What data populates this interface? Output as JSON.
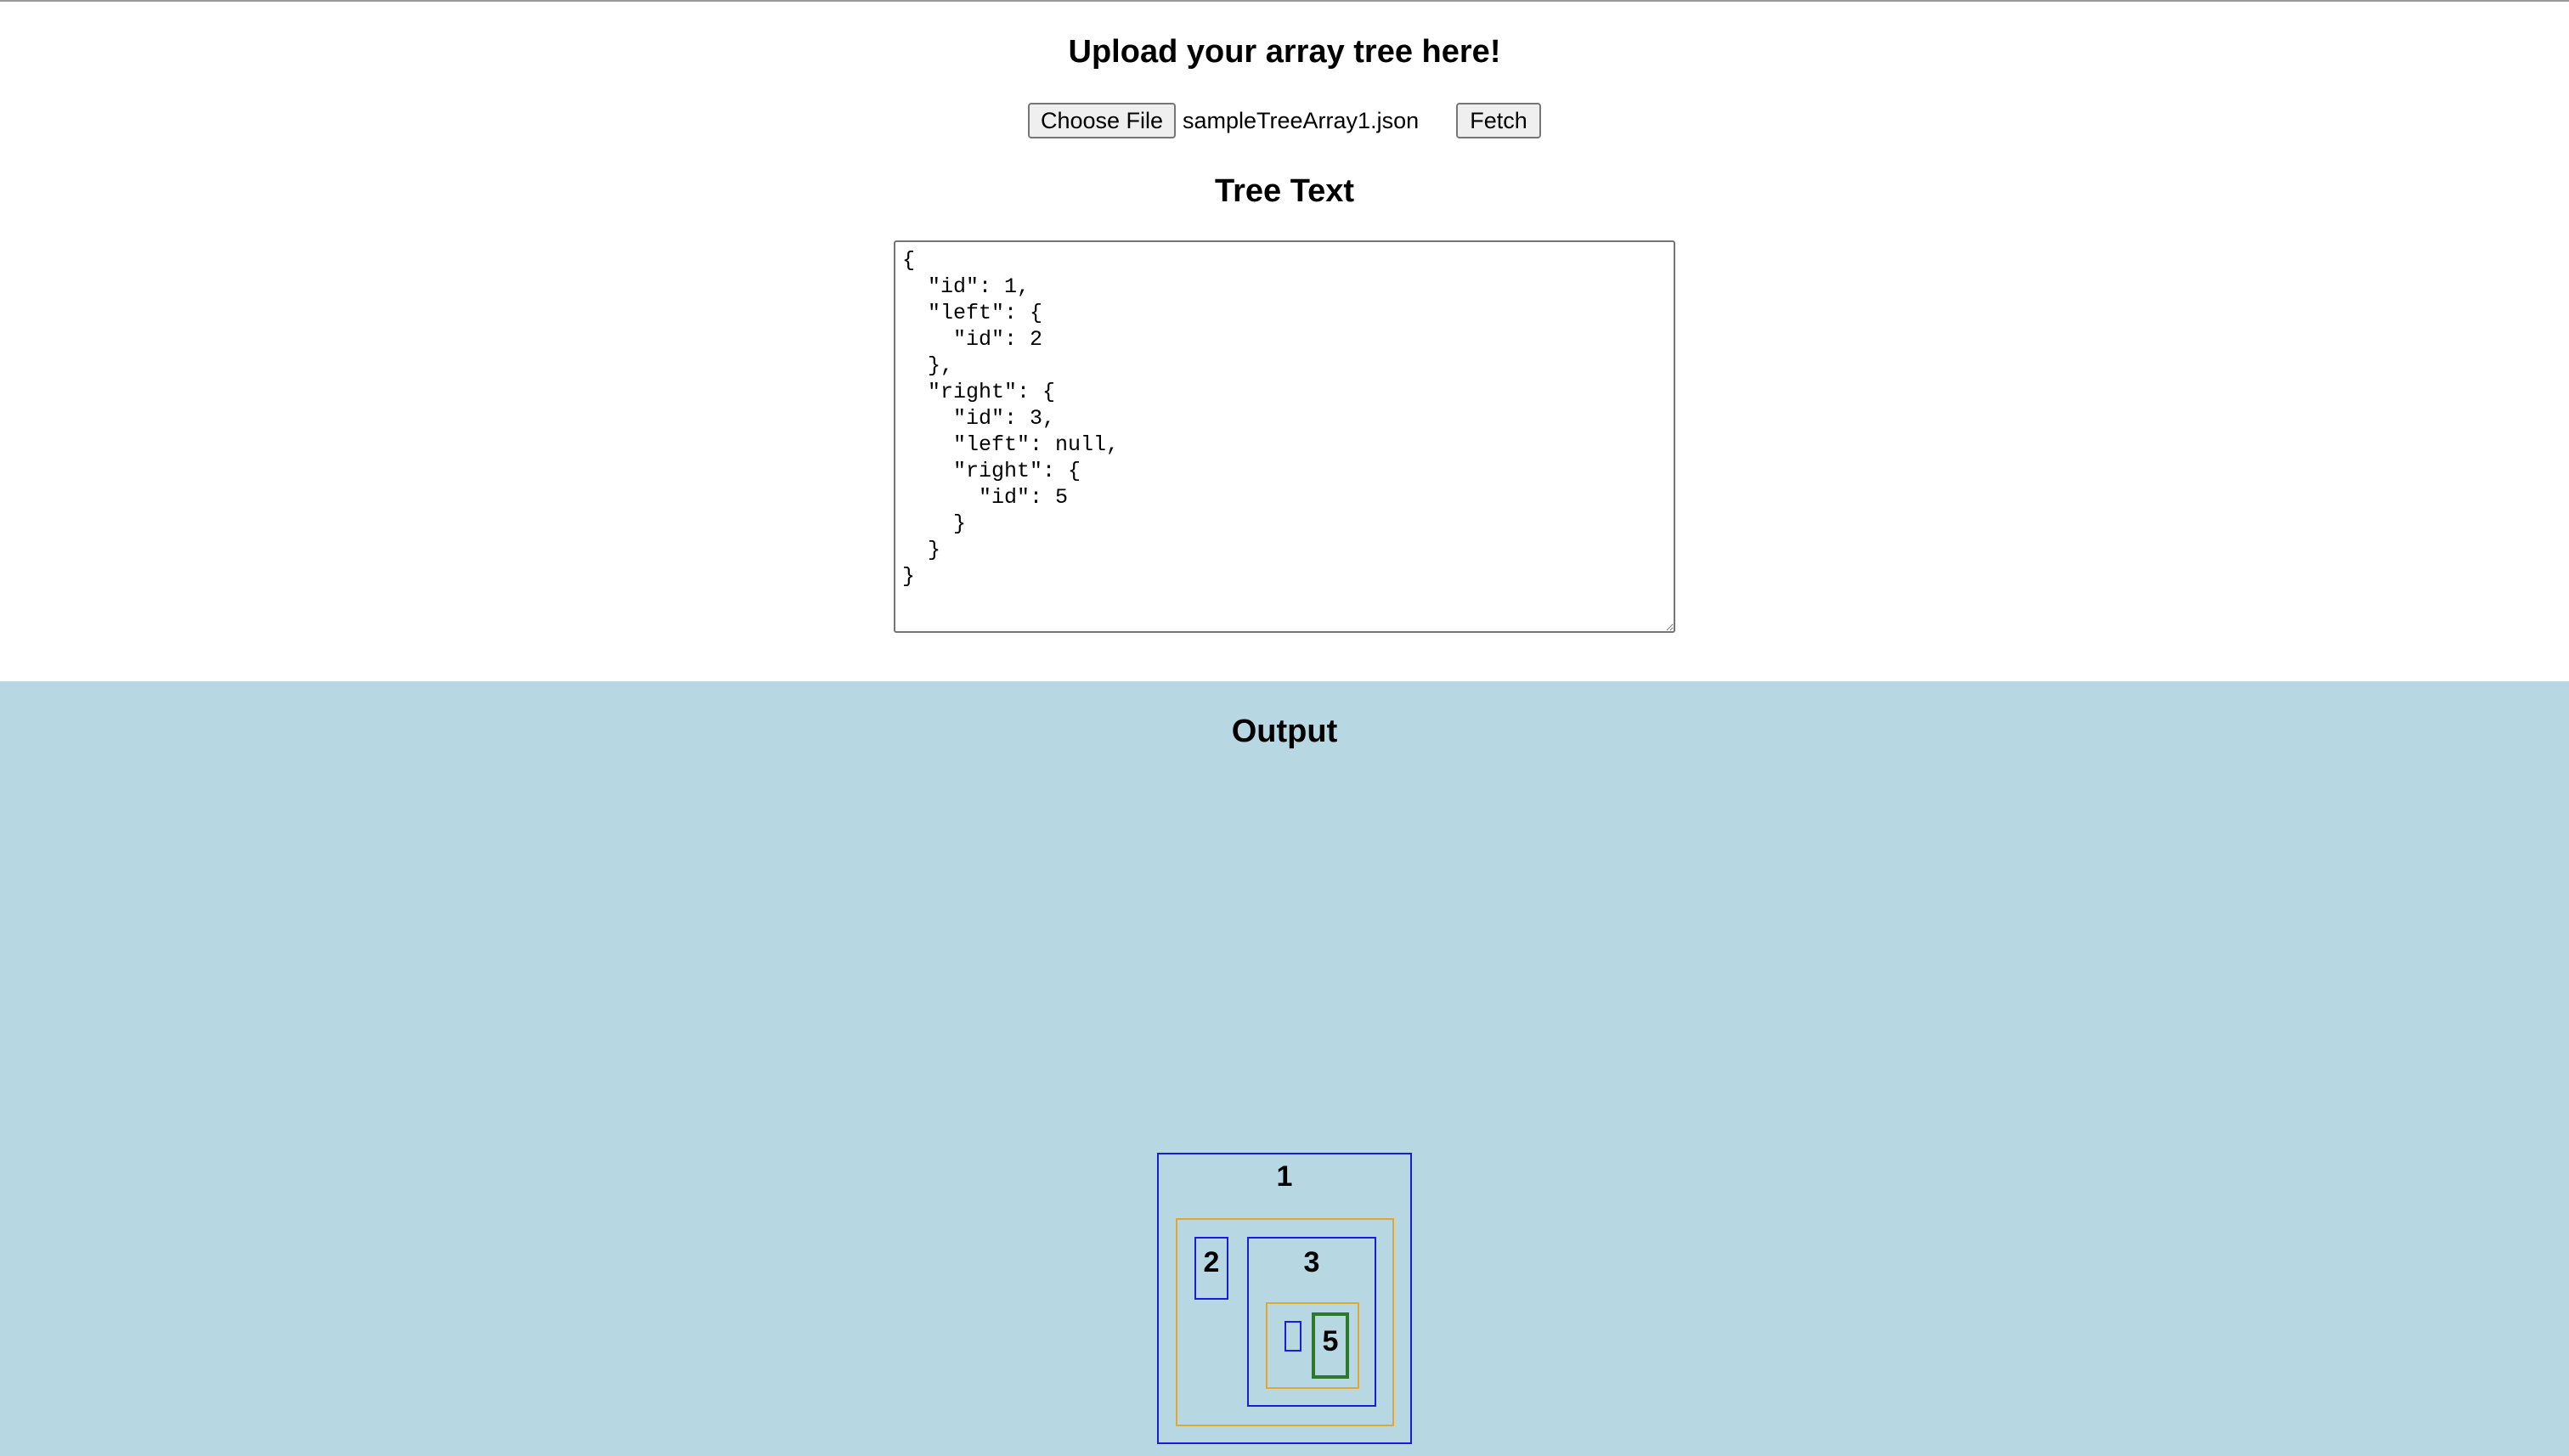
{
  "header": {
    "title": "Upload your array tree here!",
    "choose_file_label": "Choose File",
    "file_name": "sampleTreeArray1.json",
    "fetch_label": "Fetch"
  },
  "tree_text": {
    "title": "Tree Text",
    "content": "{\n  \"id\": 1,\n  \"left\": {\n    \"id\": 2\n  },\n  \"right\": {\n    \"id\": 3,\n    \"left\": null,\n    \"right\": {\n      \"id\": 5\n    }\n  }\n}"
  },
  "output": {
    "title": "Output",
    "nodes": {
      "root": "1",
      "left": "2",
      "right": "3",
      "right_left": "",
      "right_right": "5"
    }
  },
  "colors": {
    "output_background": "#b7d8e3",
    "node_border": "#1a1ae0",
    "children_border": "#e3a62e",
    "leaf_border": "#2b7a2b"
  }
}
